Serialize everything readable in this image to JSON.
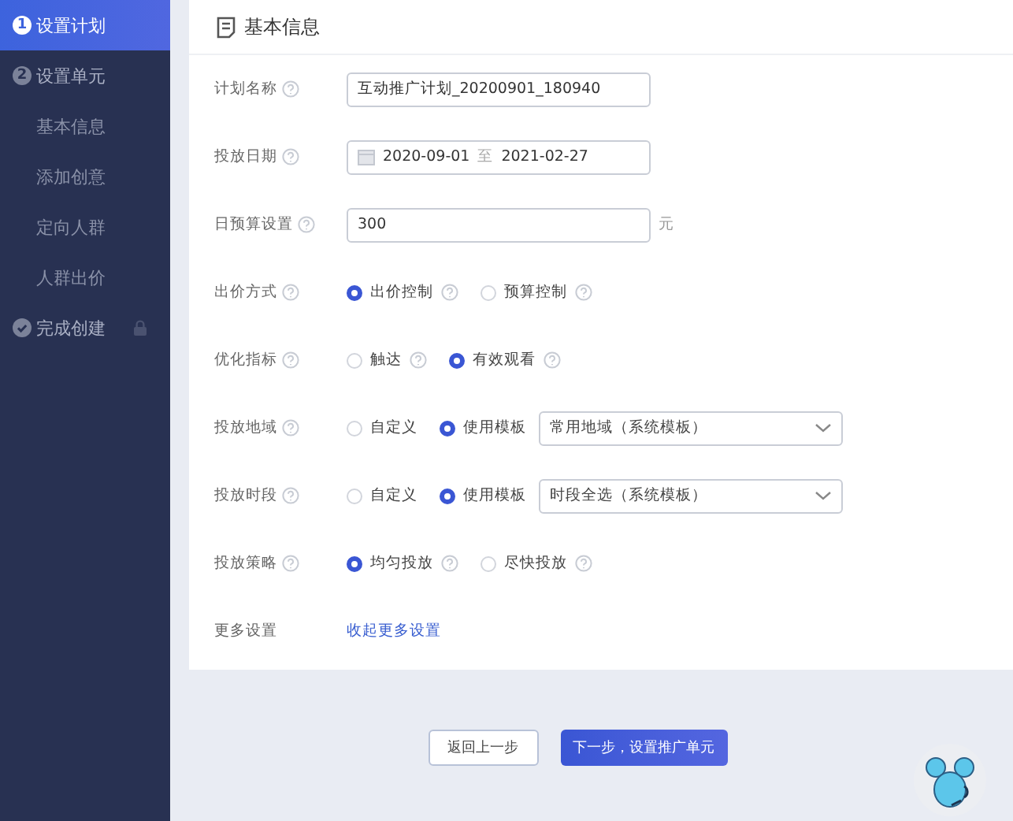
{
  "sidebar": {
    "steps": [
      {
        "kind": "step",
        "number": "1",
        "label": "设置计划",
        "selected": true
      },
      {
        "kind": "step",
        "number": "2",
        "label": "设置单元",
        "selected": false,
        "children": [
          {
            "label": "基本信息"
          },
          {
            "label": "添加创意"
          },
          {
            "label": "定向人群"
          },
          {
            "label": "人群出价"
          }
        ]
      },
      {
        "kind": "done",
        "label": "完成创建",
        "selected": false,
        "locked": true
      }
    ]
  },
  "card": {
    "title": "基本信息",
    "rows": [
      {
        "kind": "text",
        "label": "计划名称",
        "help": true,
        "value": "互动推广计划_20200901_180940"
      },
      {
        "kind": "date",
        "label": "投放日期",
        "help": true,
        "start": "2020-09-01",
        "separator": "至",
        "end": "2021-02-27"
      },
      {
        "kind": "number",
        "label": "日预算设置",
        "help": true,
        "value": "300",
        "unit": "元"
      },
      {
        "kind": "radio",
        "label": "出价方式",
        "help": true,
        "options": [
          {
            "label": "出价控制",
            "help": true,
            "selected": true
          },
          {
            "label": "预算控制",
            "help": true,
            "selected": false
          }
        ]
      },
      {
        "kind": "radio",
        "label": "优化指标",
        "help": true,
        "options": [
          {
            "label": "触达",
            "help": true,
            "selected": false
          },
          {
            "label": "有效观看",
            "help": true,
            "selected": true
          }
        ]
      },
      {
        "kind": "radio",
        "label": "投放地域",
        "help": true,
        "options": [
          {
            "label": "自定义",
            "help": false,
            "selected": false
          },
          {
            "label": "使用模板",
            "help": false,
            "selected": true
          }
        ],
        "select": "常用地域（系统模板）"
      },
      {
        "kind": "radio",
        "label": "投放时段",
        "help": true,
        "options": [
          {
            "label": "自定义",
            "help": false,
            "selected": false
          },
          {
            "label": "使用模板",
            "help": false,
            "selected": true
          }
        ],
        "select": "时段全选（系统模板）"
      },
      {
        "kind": "radio",
        "label": "投放策略",
        "help": true,
        "options": [
          {
            "label": "均匀投放",
            "help": true,
            "selected": true
          },
          {
            "label": "尽快投放",
            "help": true,
            "selected": false
          }
        ]
      },
      {
        "kind": "link",
        "label": "更多设置",
        "help": false,
        "link": "收起更多设置"
      }
    ]
  },
  "buttons": [
    {
      "kind": "secondary",
      "label": "返回上一步"
    },
    {
      "kind": "primary",
      "label": "下一步，设置推广单元"
    }
  ]
}
